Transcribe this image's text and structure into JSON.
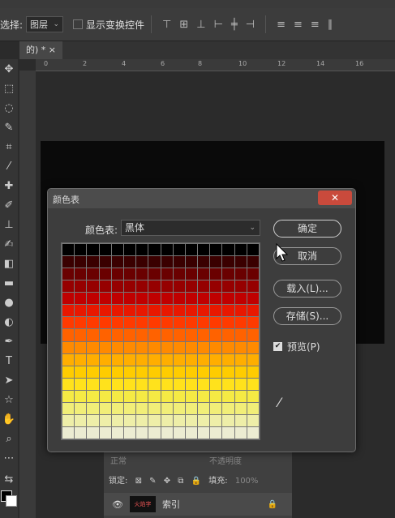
{
  "options": {
    "select_label": "选择:",
    "layer_mode": "图层",
    "show_transform": "显示变换控件",
    "align_icons": [
      "align-top",
      "align-vcenter",
      "align-bottom",
      "align-left",
      "align-hcenter",
      "align-right",
      "distribute"
    ]
  },
  "tab": {
    "label": "的) * ×"
  },
  "ruler": {
    "ticks": [
      "0",
      "2",
      "4",
      "6",
      "8",
      "10",
      "12",
      "14",
      "16"
    ]
  },
  "tools": [
    "move-icon",
    "marquee-icon",
    "lasso-icon",
    "quick-select-icon",
    "crop-icon",
    "eyedropper-icon",
    "healing-icon",
    "brush-icon",
    "stamp-icon",
    "history-brush-icon",
    "eraser-icon",
    "gradient-icon",
    "blur-icon",
    "dodge-icon",
    "pen-icon",
    "type-icon",
    "path-select-icon",
    "shape-icon",
    "hand-icon",
    "zoom-icon",
    "more-icon"
  ],
  "layers": {
    "mode": "正常",
    "opacity": "不透明度",
    "lock_label": "锁定:",
    "fill_label": "填充:",
    "fill_value": "100%",
    "layer_name": "索引",
    "thumb_text": "火焰字"
  },
  "dialog": {
    "title": "颜色表",
    "table_label": "颜色表:",
    "table_value": "黑体",
    "ok": "确定",
    "cancel": "取消",
    "load": "载入(L)...",
    "save": "存储(S)...",
    "preview_label": "预览(P)",
    "preview_checked": true
  },
  "colors": {
    "dialog_bg": "#3d3d3d",
    "close_button": "#c94a3c",
    "palette_rows": [
      "#000000",
      "#3a0000",
      "#6a0000",
      "#960000",
      "#c00000",
      "#e81800",
      "#ff3a00",
      "#ff6200",
      "#ff8a00",
      "#ffae00",
      "#ffcc00",
      "#ffe21c",
      "#f5ea44",
      "#f1ee78",
      "#eeeea8",
      "#ececd2"
    ]
  }
}
